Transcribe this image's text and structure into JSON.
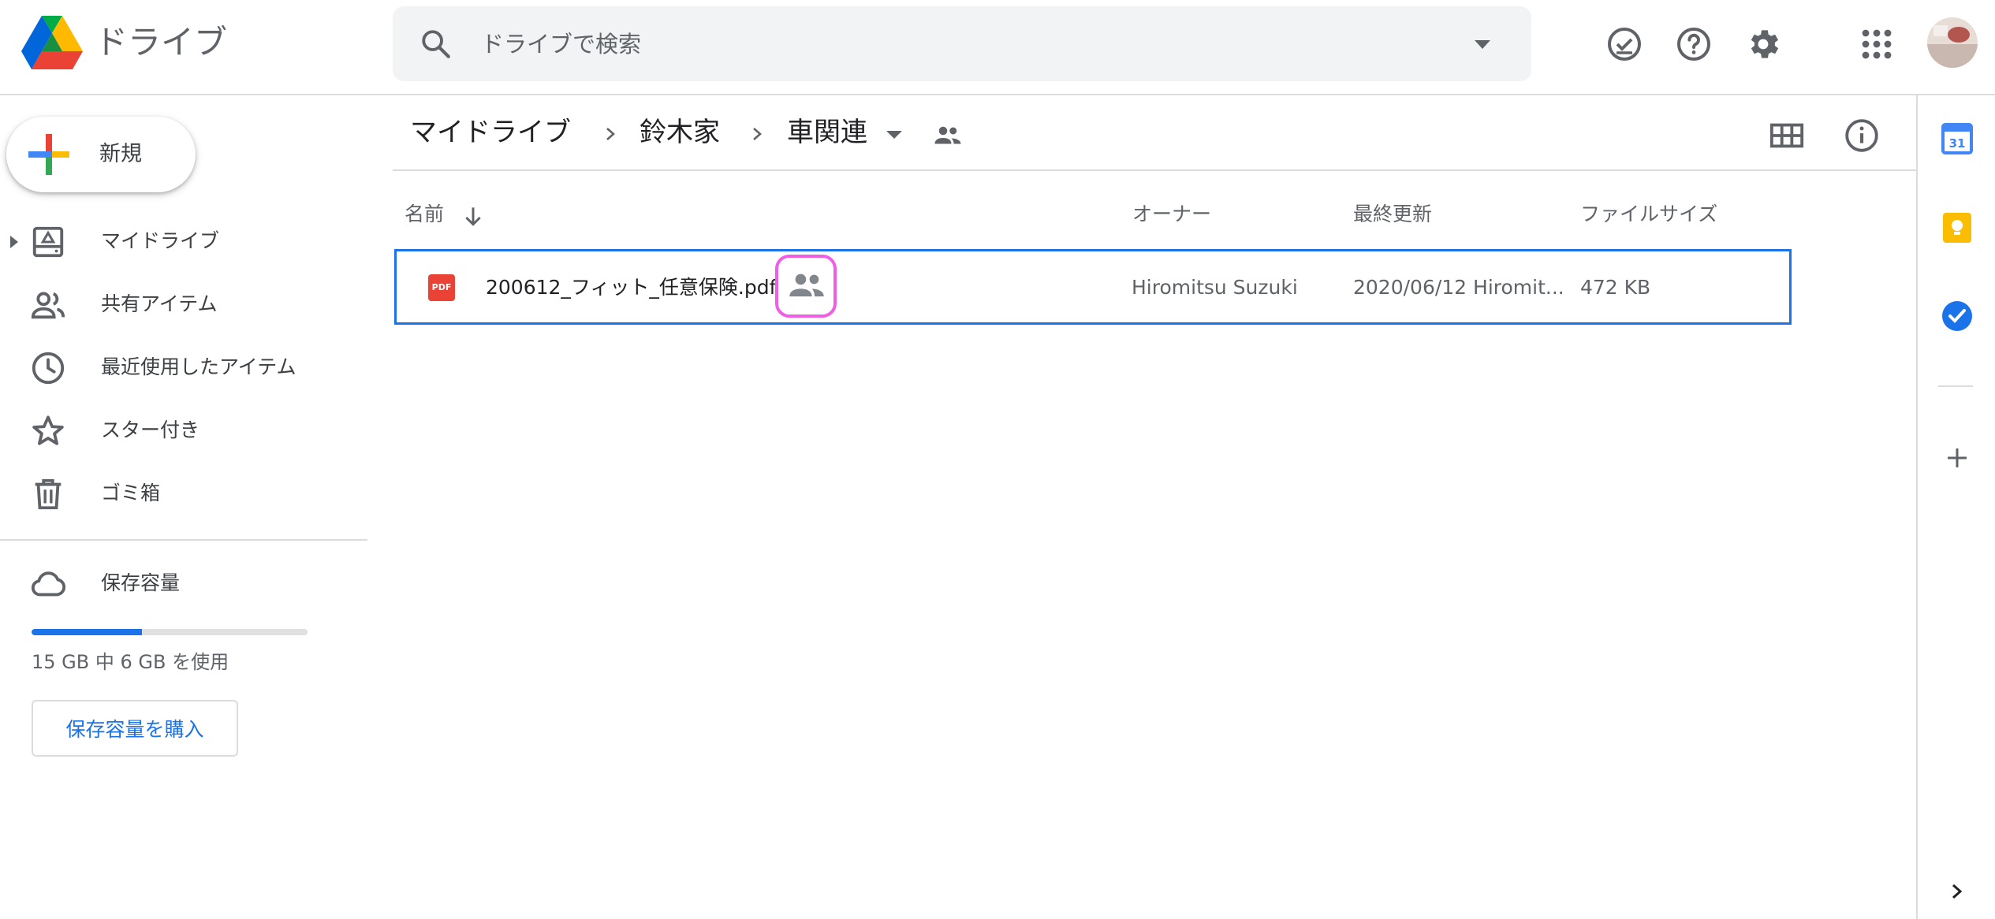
{
  "header": {
    "app_name": "ドライブ",
    "search_placeholder": "ドライブで検索"
  },
  "sidebar": {
    "new_label": "新規",
    "items": [
      {
        "label": "マイドライブ",
        "icon": "my-drive-icon"
      },
      {
        "label": "共有アイテム",
        "icon": "people-icon"
      },
      {
        "label": "最近使用したアイテム",
        "icon": "clock-icon"
      },
      {
        "label": "スター付き",
        "icon": "star-icon"
      },
      {
        "label": "ゴミ箱",
        "icon": "trash-icon"
      }
    ],
    "storage": {
      "label": "保存容量",
      "used_fraction": 0.4,
      "usage_text": "15 GB 中 6 GB を使用",
      "buy_label": "保存容量を購入"
    }
  },
  "breadcrumb": {
    "items": [
      "マイドライブ",
      "鈴木家",
      "車関連"
    ]
  },
  "table": {
    "columns": [
      "名前",
      "オーナー",
      "最終更新",
      "ファイルサイズ"
    ],
    "rows": [
      {
        "name": "200612_フィット_任意保険.pdf",
        "type_label": "PDF",
        "owner": "Hiromitsu Suzuki",
        "modified": "2020/06/12 Hiromit...",
        "size": "472 KB"
      }
    ]
  },
  "colors": {
    "accent": "#1a73e8",
    "highlight": "#f05ee6",
    "pdf_red": "#ea4335"
  }
}
